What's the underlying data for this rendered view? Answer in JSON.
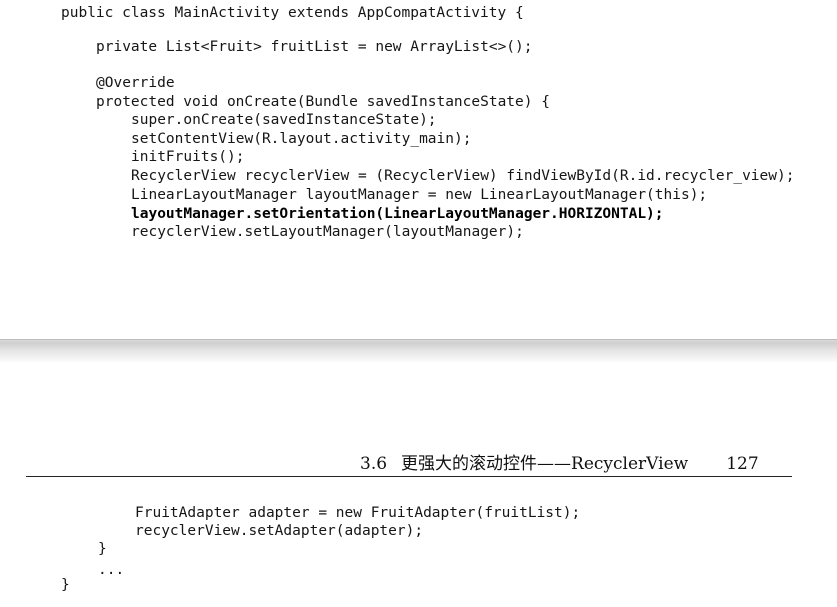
{
  "page_top": {
    "code_lines": [
      "public class MainActivity extends AppCompatActivity {",
      "private List<Fruit> fruitList = new ArrayList<>();",
      "@Override",
      "protected void onCreate(Bundle savedInstanceState) {",
      "super.onCreate(savedInstanceState);",
      "setContentView(R.layout.activity_main);",
      "initFruits();",
      "RecyclerView recyclerView = (RecyclerView) findViewById(R.id.recycler_view);",
      "LinearLayoutManager layoutManager = new LinearLayoutManager(this);",
      "layoutManager.setOrientation(LinearLayoutManager.HORIZONTAL);",
      "recyclerView.setLayoutManager(layoutManager);"
    ]
  },
  "page_bottom": {
    "header": {
      "section_number": "3.6",
      "section_title": "更强大的滚动控件——RecyclerView",
      "page_number": "127"
    },
    "code_lines": [
      "FruitAdapter adapter = new FruitAdapter(fruitList);",
      "recyclerView.setAdapter(adapter);",
      "}",
      "...",
      "}"
    ]
  }
}
